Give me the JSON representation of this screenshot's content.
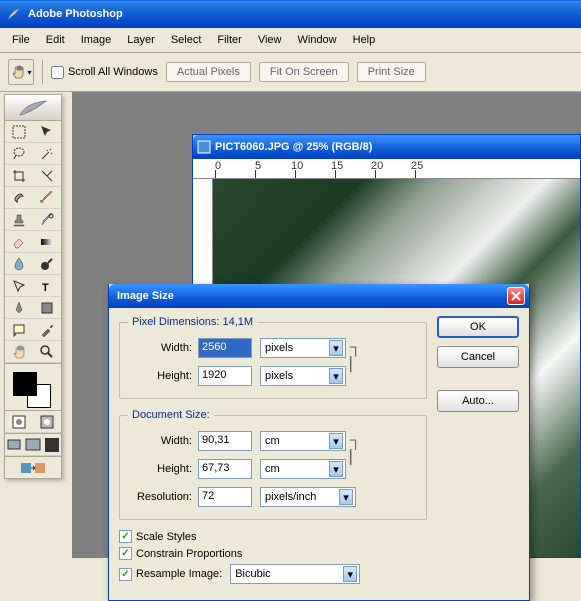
{
  "app": {
    "title": "Adobe Photoshop"
  },
  "menu": [
    "File",
    "Edit",
    "Image",
    "Layer",
    "Select",
    "Filter",
    "View",
    "Window",
    "Help"
  ],
  "options_bar": {
    "scroll_all": "Scroll All Windows",
    "buttons": [
      "Actual Pixels",
      "Fit On Screen",
      "Print Size"
    ]
  },
  "document": {
    "title": "PICT6060.JPG @ 25% (RGB/8)"
  },
  "dialog": {
    "title": "Image Size",
    "pixel_dimensions_legend": "Pixel Dimensions:  14,1M",
    "document_size_legend": "Document Size:",
    "width_label": "Width:",
    "height_label": "Height:",
    "resolution_label": "Resolution:",
    "px_width": "2560",
    "px_height": "1920",
    "px_unit": "pixels",
    "doc_width": "90,31",
    "doc_height": "67,73",
    "doc_unit": "cm",
    "resolution": "72",
    "res_unit": "pixels/inch",
    "scale_styles": "Scale Styles",
    "constrain": "Constrain Proportions",
    "resample": "Resample Image:",
    "resample_method": "Bicubic",
    "ok": "OK",
    "cancel": "Cancel",
    "auto": "Auto..."
  }
}
